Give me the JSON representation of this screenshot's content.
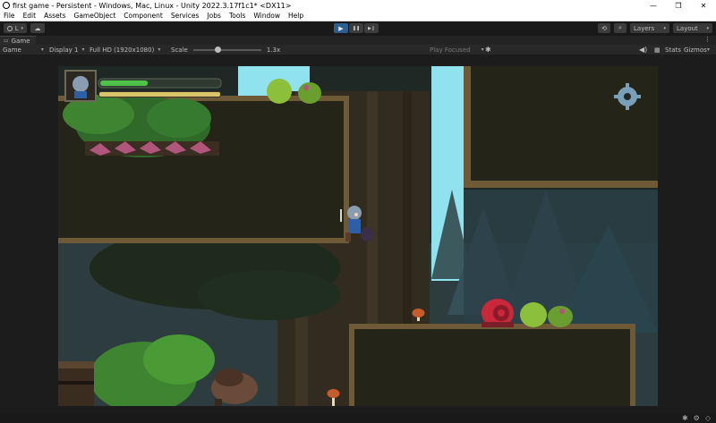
{
  "window": {
    "title": "first game - Persistent - Windows, Mac, Linux - Unity 2022.3.17f1c1* <DX11>",
    "minimize_glyph": "—",
    "maximize_glyph": "❐",
    "close_glyph": "✕"
  },
  "menu": [
    "File",
    "Edit",
    "Assets",
    "GameObject",
    "Component",
    "Services",
    "Jobs",
    "Tools",
    "Window",
    "Help"
  ],
  "toolbar": {
    "account_label": "L",
    "play_glyph": "▶",
    "pause_glyph": "❚❚",
    "step_glyph": "▶❙",
    "layers_label": "Layers",
    "layout_label": "Layout"
  },
  "tab": {
    "label": "Game"
  },
  "game_toolbar": {
    "view_label": "Game",
    "display_label": "Display 1",
    "resolution_label": "Full HD (1920x1080)",
    "scale_label": "Scale",
    "scale_value": "1.3x",
    "scale_fraction": 0.37,
    "play_focused_label": "Play Focused",
    "stats_label": "Stats",
    "gizmos_label": "Gizmos"
  },
  "hud": {
    "health_fraction": 0.4,
    "stamina_fraction": 1.0,
    "health_color": "#4fc24a",
    "stamina_color": "#d9c46a"
  },
  "colors": {
    "sky": "#8fe2ee",
    "dirt": "#2b2a1d",
    "dirt_edge": "#6e5a36",
    "bark": "#3a3326",
    "leaf": "#2f6a2b",
    "leaf_light": "#5aa33a",
    "accent_blue": "#2d5e8e"
  }
}
